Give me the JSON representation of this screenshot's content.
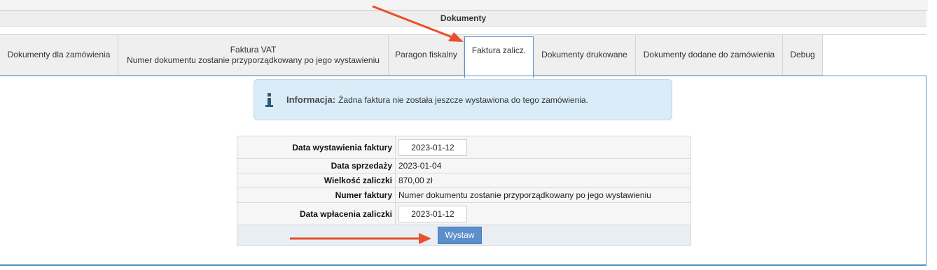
{
  "section": {
    "title": "Dokumenty"
  },
  "tabs": [
    {
      "lines": [
        "Dokumenty dla zamówienia"
      ]
    },
    {
      "lines": [
        "Faktura VAT",
        "Numer dokumentu zostanie przyporządkowany po jego wystawieniu"
      ]
    },
    {
      "lines": [
        "Paragon fiskalny"
      ]
    },
    {
      "lines": [
        "Faktura zalicz."
      ],
      "active": true
    },
    {
      "lines": [
        "Dokumenty drukowane"
      ]
    },
    {
      "lines": [
        "Dokumenty dodane do zamówienia"
      ]
    },
    {
      "lines": [
        "Debug"
      ]
    }
  ],
  "info": {
    "icon": "info-icon",
    "title": "Informacja:",
    "message": "Żadna faktura nie została jeszcze wystawiona do tego zamówienia."
  },
  "form": {
    "issue_date_label": "Data wystawienia faktury",
    "issue_date_value": "2023-01-12",
    "sale_date_label": "Data sprzedaży",
    "sale_date_value": "2023-01-04",
    "advance_amount_label": "Wielkość zaliczki",
    "advance_amount_value": "870,00 zł",
    "invoice_number_label": "Numer faktury",
    "invoice_number_value": "Numer dokumentu zostanie przyporządkowany po jego wystawieniu",
    "payment_date_label": "Data wpłacenia zaliczki",
    "payment_date_value": "2023-01-12",
    "submit_label": "Wystaw"
  },
  "colors": {
    "accent": "#5b8fc9",
    "annotation_arrow": "#e8502a",
    "info_bg": "#d9ecf7"
  }
}
